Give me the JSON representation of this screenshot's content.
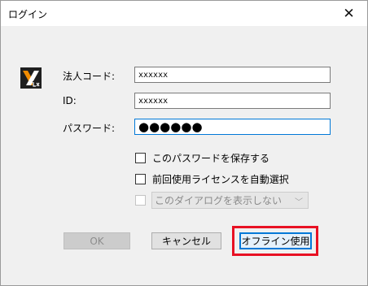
{
  "window": {
    "title": "ログイン",
    "close_glyph": "✕"
  },
  "form": {
    "company_code_label": "法人コード:",
    "company_code_value": "xxxxxx",
    "id_label": "ID:",
    "id_value": "xxxxxx",
    "password_label": "パスワード:",
    "password_value": "●●●●●●"
  },
  "options": {
    "save_password_label": "このパスワードを保存する",
    "save_password_checked": false,
    "auto_select_license_label": "前回使用ライセンスを自動選択",
    "auto_select_license_checked": false,
    "dont_show_dialog_label": "このダイアログを表示しない",
    "dont_show_dialog_enabled": false,
    "chevron_glyph": "﹀"
  },
  "buttons": {
    "ok_label": "OK",
    "cancel_label": "キャンセル",
    "offline_label": "オフライン使用"
  },
  "colors": {
    "highlight": "#e81123",
    "focus_border": "#0078d7",
    "logo_orange": "#f28c00"
  },
  "icons": {
    "logo": "xlx-logo-icon",
    "close": "close-icon",
    "dropdown": "chevron-down-icon"
  }
}
